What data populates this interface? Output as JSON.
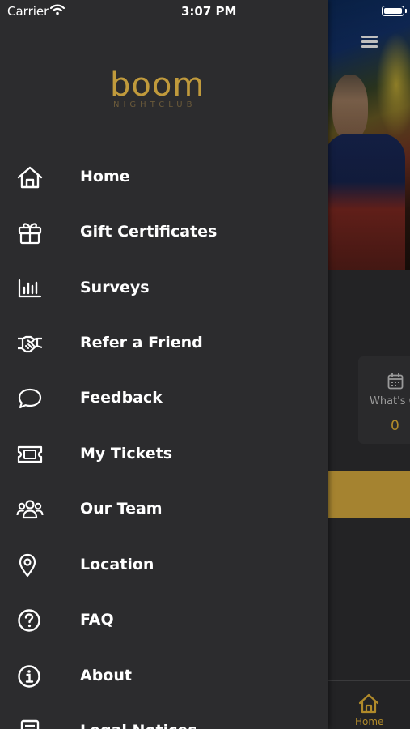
{
  "status_bar": {
    "carrier": "Carrier",
    "time": "3:07 PM"
  },
  "brand": {
    "name": "boom",
    "tagline": "NIGHTCLUB",
    "color": "#c09a3c"
  },
  "menu": {
    "items": [
      {
        "label": "Home",
        "icon": "home-icon"
      },
      {
        "label": "Gift Certificates",
        "icon": "gift-icon"
      },
      {
        "label": "Surveys",
        "icon": "bar-chart-icon"
      },
      {
        "label": "Refer a Friend",
        "icon": "handshake-icon"
      },
      {
        "label": "Feedback",
        "icon": "chat-bubble-icon"
      },
      {
        "label": "My Tickets",
        "icon": "ticket-icon"
      },
      {
        "label": "Our Team",
        "icon": "team-icon"
      },
      {
        "label": "Location",
        "icon": "location-pin-icon"
      },
      {
        "label": "FAQ",
        "icon": "question-circle-icon"
      },
      {
        "label": "About",
        "icon": "info-circle-icon"
      },
      {
        "label": "Legal Notices",
        "icon": "document-icon"
      }
    ]
  },
  "background": {
    "card_label": "What's C",
    "card_count": "0",
    "tab_label": "Home",
    "accent": "#a58330"
  }
}
